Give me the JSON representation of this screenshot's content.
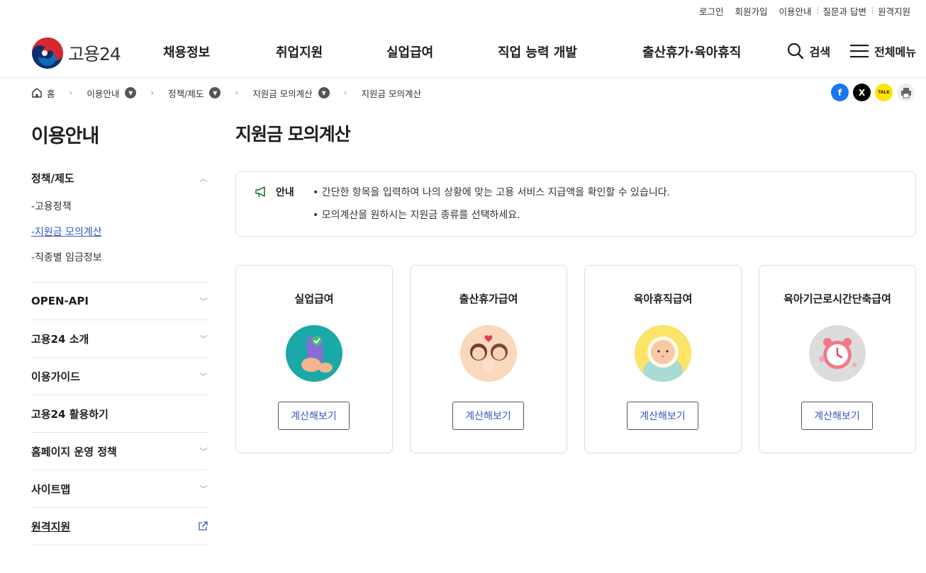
{
  "util_links": [
    "로그인",
    "회원가입",
    "이용안내",
    "질문과 답변",
    "원격지원"
  ],
  "logo": {
    "text": "고용24"
  },
  "gnb": [
    "채용정보",
    "취업지원",
    "실업급여",
    "직업 능력 개발",
    "출산휴가·육아휴직"
  ],
  "search_label": "검색",
  "menu_label": "전체메뉴",
  "breadcrumb": {
    "home": "홈",
    "items": [
      "이용안내",
      "정책/제도",
      "지원금 모의계산",
      "지원금 모의계산"
    ]
  },
  "share": {
    "facebook": "f",
    "x": "X",
    "kakao": "TALK"
  },
  "sidebar": {
    "title": "이용안내",
    "groups": [
      {
        "label": "정책/제도",
        "items": [
          "-고용정책",
          "-지원금 모의계산",
          "-직종별 임금정보"
        ]
      },
      {
        "label": "OPEN-API"
      },
      {
        "label": "고용24 소개"
      },
      {
        "label": "이용가이드"
      },
      {
        "label": "고용24 활용하기"
      },
      {
        "label": "홈페이지 운영 정책"
      },
      {
        "label": "사이트맵"
      },
      {
        "label": "원격지원"
      }
    ]
  },
  "page_title": "지원금 모의계산",
  "notice": {
    "label": "안내",
    "lines": [
      "• 간단한 항목을 입력하여 나의 상황에 맞는 고용 서비스 지급액을 확인할 수 있습니다.",
      "• 모의계산을 원하시는 지원금 종류를 선택하세요."
    ]
  },
  "cards": [
    {
      "title": "실업급여",
      "button": "계산해보기"
    },
    {
      "title": "출산휴가급여",
      "button": "계산해보기"
    },
    {
      "title": "육아휴직급여",
      "button": "계산해보기"
    },
    {
      "title": "육아기근로시간단축급여",
      "button": "계산해보기"
    }
  ],
  "colors": {
    "accent": "#3a57c4",
    "facebook": "#1877f2",
    "kakao": "#fee500"
  }
}
